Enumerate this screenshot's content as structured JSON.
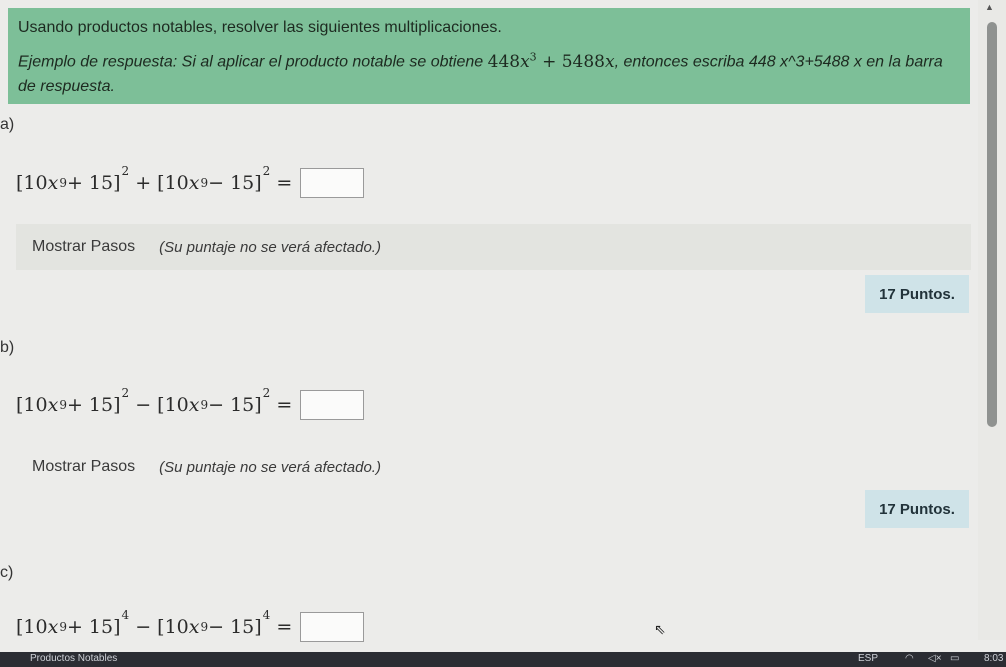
{
  "banner": {
    "title": "Usando productos notables, resolver las siguientes multiplicaciones.",
    "example_prefix": "Ejemplo de respuesta: Si al aplicar el producto notable se obtiene ",
    "example_math": {
      "a": "448",
      "var": "x",
      "exp": "3",
      "plus": " + ",
      "b": "5488",
      "var2": "x"
    },
    "example_middle": ", entonces escriba ",
    "example_answer": "448 x^3+5488 x",
    "example_suffix": " en la barra de respuesta."
  },
  "questions": [
    {
      "letter": "a)",
      "open": "[10",
      "var": "x",
      "inner_exp": "9",
      "plus": " + 15]",
      "outer_exp": "2",
      "op": " + ",
      "open2": "[10",
      "var2": "x",
      "inner_exp2": "9",
      "minus": " − 15]",
      "outer_exp2": "2",
      "eq": " =",
      "steps_label": "Mostrar Pasos",
      "steps_note": "(Su puntaje no se verá afectado.)",
      "points": "17 Puntos."
    },
    {
      "letter": "b)",
      "open": "[10",
      "var": "x",
      "inner_exp": "9",
      "plus": " + 15]",
      "outer_exp": "2",
      "op": " − ",
      "open2": "[10",
      "var2": "x",
      "inner_exp2": "9",
      "minus": " − 15]",
      "outer_exp2": "2",
      "eq": " =",
      "steps_label": "Mostrar Pasos",
      "steps_note": "(Su puntaje no se verá afectado.)",
      "points": "17 Puntos."
    },
    {
      "letter": "c)",
      "open": "[10",
      "var": "x",
      "inner_exp": "9",
      "plus": " + 15]",
      "outer_exp": "4",
      "op": " − ",
      "open2": "[10",
      "var2": "x",
      "inner_exp2": "9",
      "minus": " − 15]",
      "outer_exp2": "4",
      "eq": " ="
    }
  ],
  "taskbar": {
    "left_text": "Productos Notables",
    "lang": "ESP",
    "clock": "8:03"
  }
}
